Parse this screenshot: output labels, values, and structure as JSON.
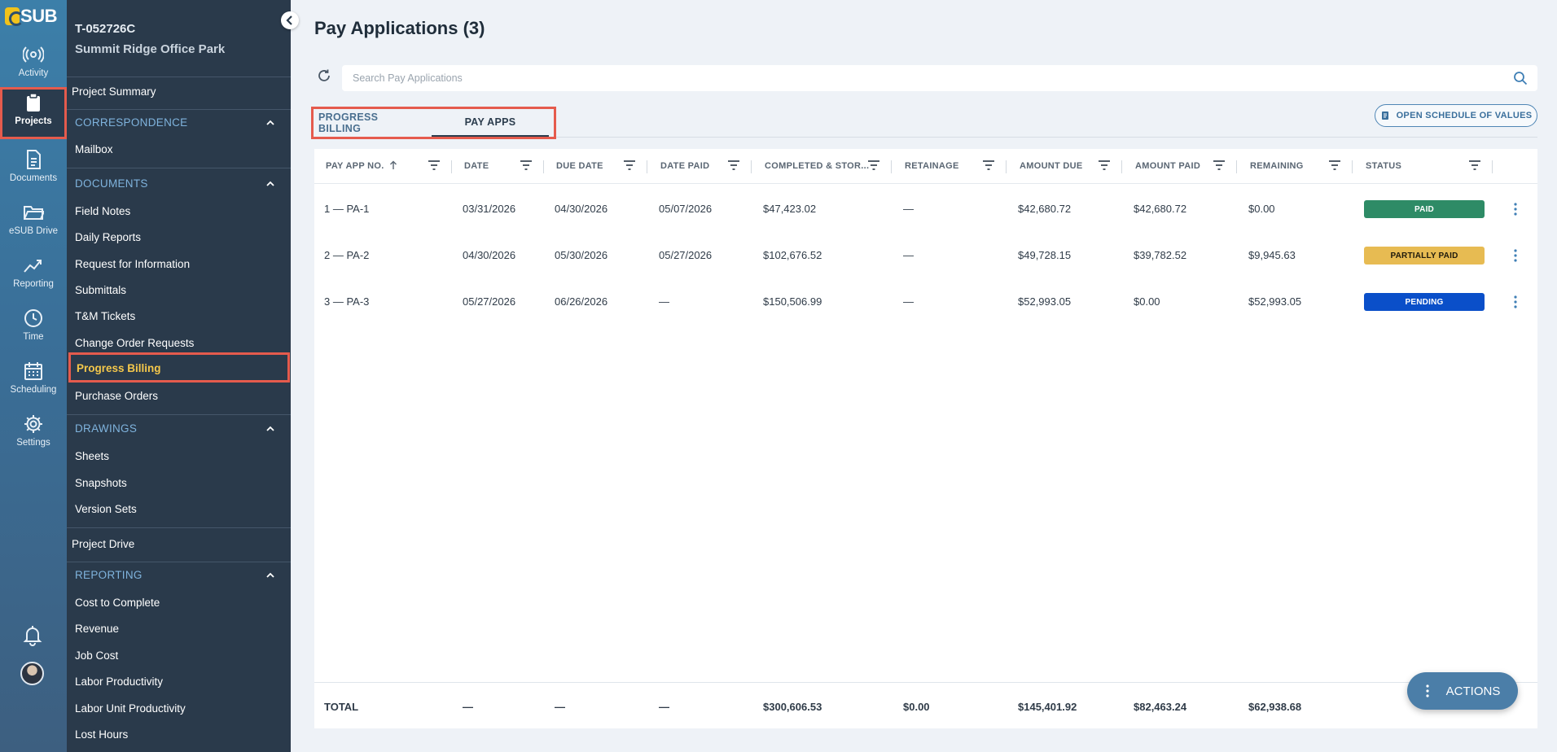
{
  "app": {
    "logo_text": "SUB"
  },
  "rail": {
    "items": [
      {
        "label": "Activity",
        "icon": "activity-icon"
      },
      {
        "label": "Projects",
        "icon": "clipboard-icon",
        "active": true
      },
      {
        "label": "Documents",
        "icon": "document-icon"
      },
      {
        "label": "eSUB Drive",
        "icon": "folder-icon"
      },
      {
        "label": "Reporting",
        "icon": "trend-icon"
      },
      {
        "label": "Time",
        "icon": "clock-icon"
      },
      {
        "label": "Scheduling",
        "icon": "calendar-icon"
      },
      {
        "label": "Settings",
        "icon": "gear-icon"
      }
    ]
  },
  "project": {
    "id": "T-052726C",
    "name": "Summit Ridge Office Park"
  },
  "nav": {
    "project_summary": "Project Summary",
    "correspondence": "CORRESPONDENCE",
    "mailbox": "Mailbox",
    "documents": "DOCUMENTS",
    "document_items": [
      "Field Notes",
      "Daily Reports",
      "Request for Information",
      "Submittals",
      "T&M Tickets",
      "Change Order Requests"
    ],
    "progress_billing": "Progress Billing",
    "purchase_orders": "Purchase Orders",
    "drawings": "DRAWINGS",
    "drawing_items": [
      "Sheets",
      "Snapshots",
      "Version Sets"
    ],
    "project_drive": "Project Drive",
    "reporting": "REPORTING",
    "reporting_items": [
      "Cost to Complete",
      "Revenue",
      "Job Cost",
      "Labor Productivity",
      "Labor Unit Productivity",
      "Lost Hours"
    ]
  },
  "page": {
    "title": "Pay Applications (3)",
    "search_placeholder": "Search Pay Applications",
    "tabs": [
      "PROGRESS BILLING",
      "PAY APPS"
    ],
    "sov_button": "OPEN SCHEDULE OF VALUES",
    "actions_button": "ACTIONS"
  },
  "table": {
    "columns": [
      "PAY APP NO.",
      "DATE",
      "DUE DATE",
      "DATE PAID",
      "COMPLETED & STOR...",
      "RETAINAGE",
      "AMOUNT DUE",
      "AMOUNT PAID",
      "REMAINING",
      "STATUS"
    ],
    "rows": [
      {
        "no": "1 — PA-1",
        "date": "03/31/2026",
        "due": "04/30/2026",
        "paid_date": "05/07/2026",
        "completed": "$47,423.02",
        "retainage": "—",
        "amount_due": "$42,680.72",
        "amount_paid": "$42,680.72",
        "remaining": "$0.00",
        "status": "PAID"
      },
      {
        "no": "2 — PA-2",
        "date": "04/30/2026",
        "due": "05/30/2026",
        "paid_date": "05/27/2026",
        "completed": "$102,676.52",
        "retainage": "—",
        "amount_due": "$49,728.15",
        "amount_paid": "$39,782.52",
        "remaining": "$9,945.63",
        "status": "PARTIALLY PAID"
      },
      {
        "no": "3 — PA-3",
        "date": "05/27/2026",
        "due": "06/26/2026",
        "paid_date": "—",
        "completed": "$150,506.99",
        "retainage": "—",
        "amount_due": "$52,993.05",
        "amount_paid": "$0.00",
        "remaining": "$52,993.05",
        "status": "PENDING"
      }
    ],
    "totals": {
      "label": "TOTAL",
      "date": "—",
      "due": "—",
      "paid_date": "—",
      "completed": "$300,606.53",
      "retainage": "$0.00",
      "amount_due": "$145,401.92",
      "amount_paid": "$82,463.24",
      "remaining": "$62,938.68"
    }
  },
  "colors": {
    "paid": "#2e8b66",
    "partial": "#e7bb52",
    "pending": "#0a4fc9",
    "accent_highlight": "#e55b4d"
  }
}
